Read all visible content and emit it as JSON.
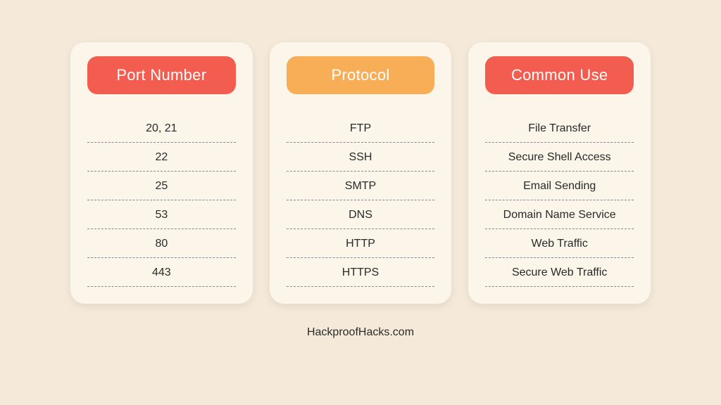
{
  "columns": [
    {
      "header": "Port Number",
      "color": "red",
      "rows": [
        "20, 21",
        "22",
        "25",
        "53",
        "80",
        "443"
      ]
    },
    {
      "header": "Protocol",
      "color": "orange",
      "rows": [
        "FTP",
        "SSH",
        "SMTP",
        "DNS",
        "HTTP",
        "HTTPS"
      ]
    },
    {
      "header": "Common Use",
      "color": "red",
      "rows": [
        "File Transfer",
        "Secure Shell Access",
        "Email Sending",
        "Domain Name Service",
        "Web Traffic",
        "Secure Web Traffic"
      ]
    }
  ],
  "footer": "HackproofHacks.com"
}
